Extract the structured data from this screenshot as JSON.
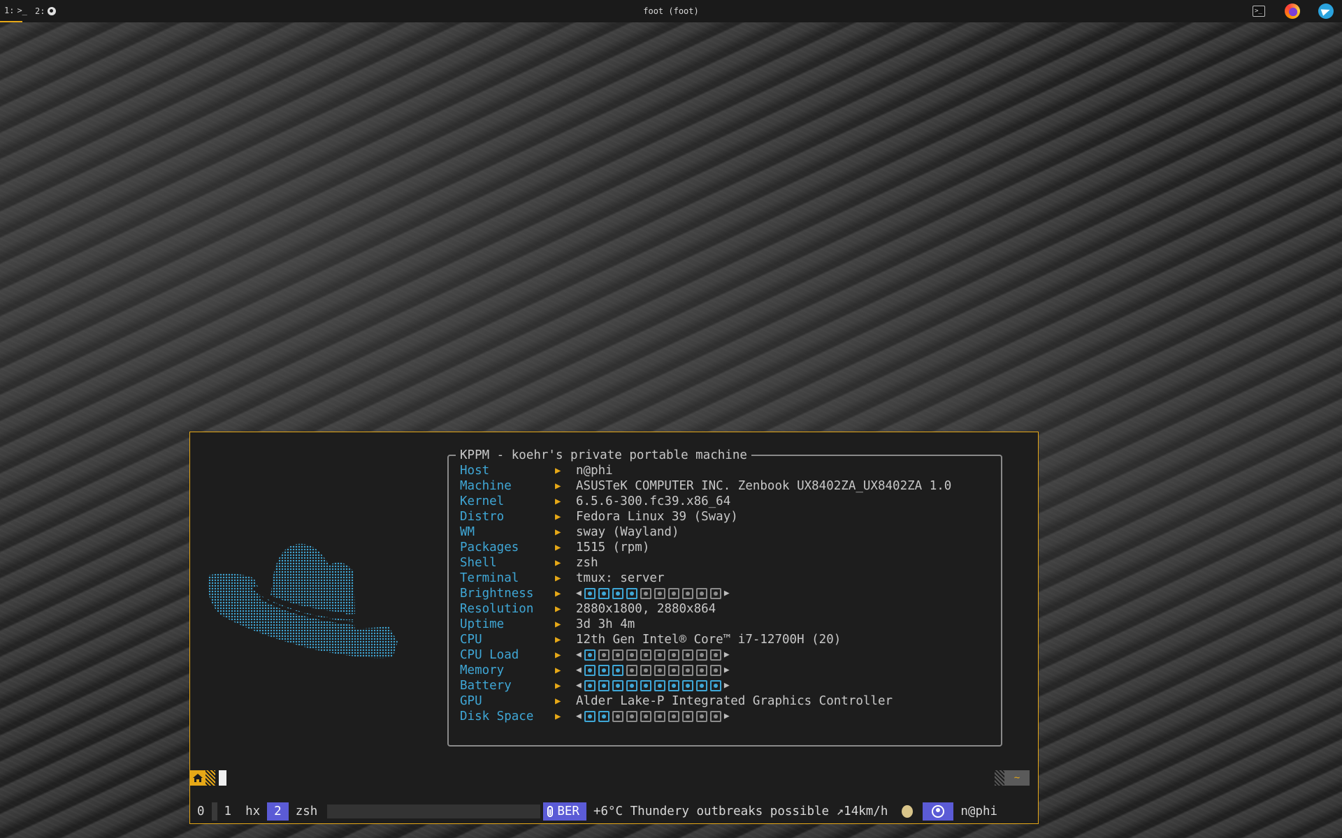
{
  "topbar": {
    "workspaces": [
      {
        "label": "1:",
        "glyph": ">_",
        "icon": "terminal-icon",
        "active": true
      },
      {
        "label": "2:",
        "icon": "app-icon",
        "active": false
      }
    ],
    "window_title": "foot (foot)",
    "tray": [
      "terminal-icon",
      "firefox-icon",
      "telegram-icon"
    ]
  },
  "fetch": {
    "title": "KPPM - koehr's private portable machine",
    "rows": [
      {
        "key": "Host",
        "value": "n@phi"
      },
      {
        "key": "Machine",
        "value": "ASUSTeK COMPUTER INC. Zenbook UX8402ZA_UX8402ZA 1.0"
      },
      {
        "key": "Kernel",
        "value": "6.5.6-300.fc39.x86_64"
      },
      {
        "key": "Distro",
        "value": "Fedora Linux 39 (Sway)"
      },
      {
        "key": "WM",
        "value": "sway (Wayland)"
      },
      {
        "key": "Packages",
        "value": "1515 (rpm)"
      },
      {
        "key": "Shell",
        "value": "zsh"
      },
      {
        "key": "Terminal",
        "value": "tmux: server"
      },
      {
        "key": "Brightness",
        "gauge": 4
      },
      {
        "key": "Resolution",
        "value": "2880x1800, 2880x864"
      },
      {
        "key": "Uptime",
        "value": "3d 3h 4m"
      },
      {
        "key": "CPU",
        "value": "12th Gen Intel® Core™ i7-12700H (20)"
      },
      {
        "key": "CPU Load",
        "gauge": 1
      },
      {
        "key": "Memory",
        "gauge": 3
      },
      {
        "key": "Battery",
        "gauge": 10
      },
      {
        "key": "GPU",
        "value": "Alder Lake-P Integrated Graphics Controller"
      },
      {
        "key": "Disk Space",
        "gauge": 2
      }
    ],
    "gauge_cells": 10
  },
  "prompt": {
    "right_label": "~"
  },
  "status": {
    "windows": [
      {
        "index": "0",
        "name": ""
      },
      {
        "index": "1",
        "name": "hx"
      },
      {
        "index": "2",
        "name": "zsh",
        "active": true
      }
    ],
    "location": "BER",
    "weather": "+6°C Thundery outbreaks possible ↗14km/h",
    "user": "n@phi"
  },
  "colors": {
    "accent": "#e6a817",
    "key": "#3fa7d6",
    "tmux_active": "#5b5bd6"
  }
}
